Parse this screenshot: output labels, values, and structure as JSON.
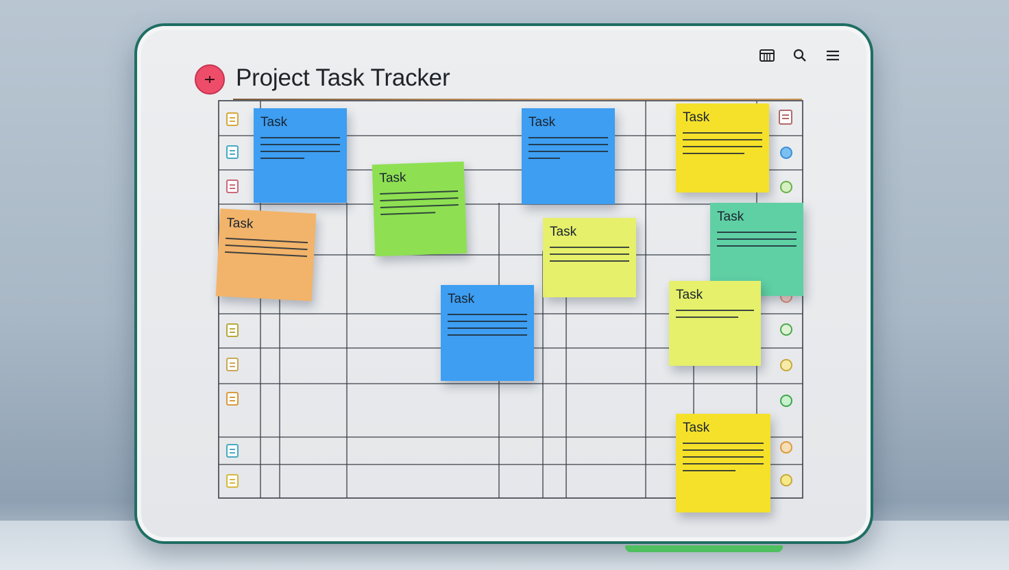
{
  "app": {
    "title": "Project Task Tracker"
  },
  "toolbar": {
    "icons": [
      "calendar-icon",
      "search-icon",
      "menu-icon"
    ]
  },
  "notes": [
    {
      "label": "Task",
      "color": "#3d9ef2"
    },
    {
      "label": "Task",
      "color": "#8ee052"
    },
    {
      "label": "Task",
      "color": "#3d9ef2"
    },
    {
      "label": "Task",
      "color": "#f5e12a"
    },
    {
      "label": "Task",
      "color": "#f2b46a"
    },
    {
      "label": "Task",
      "color": "#e6f06a"
    },
    {
      "label": "Task",
      "color": "#5fd0a4"
    },
    {
      "label": "Task",
      "color": "#3d9ef2"
    },
    {
      "label": "Task",
      "color": "#e6f06a"
    },
    {
      "label": "Task",
      "color": "#f5e12a"
    }
  ],
  "colors": {
    "frame": "#1f6e63",
    "logo": "#ee4d6a",
    "grid_line": "#3a4048"
  }
}
